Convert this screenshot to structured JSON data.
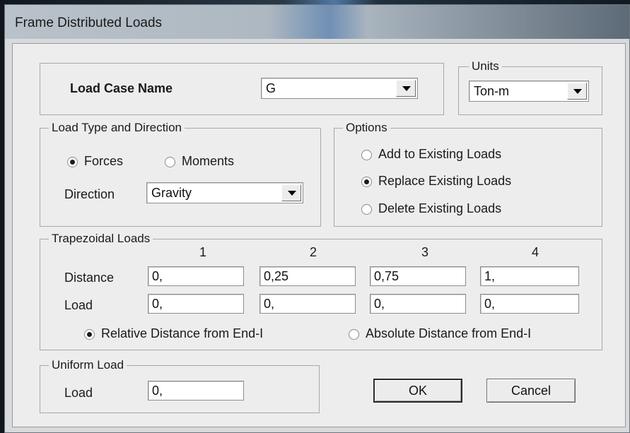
{
  "window": {
    "title": "Frame Distributed Loads"
  },
  "load_case": {
    "label": "Load Case Name",
    "value": "G"
  },
  "units": {
    "legend": "Units",
    "value": "Ton-m"
  },
  "load_type": {
    "legend": "Load Type and Direction",
    "forces_label": "Forces",
    "moments_label": "Moments",
    "selected": "Forces",
    "direction_label": "Direction",
    "direction_value": "Gravity"
  },
  "options": {
    "legend": "Options",
    "add_label": "Add to Existing Loads",
    "replace_label": "Replace Existing Loads",
    "delete_label": "Delete Existing Loads",
    "selected": "Replace Existing Loads"
  },
  "trapezoidal": {
    "legend": "Trapezoidal Loads",
    "columns": [
      "1",
      "2",
      "3",
      "4"
    ],
    "distance_label": "Distance",
    "load_label": "Load",
    "distances": [
      "0,",
      "0,25",
      "0,75",
      "1,"
    ],
    "loads": [
      "0,",
      "0,",
      "0,",
      "0,"
    ],
    "relative_label": "Relative Distance from End-I",
    "absolute_label": "Absolute Distance from End-I",
    "selected": "Relative Distance from End-I"
  },
  "uniform": {
    "legend": "Uniform Load",
    "load_label": "Load",
    "value": "0,"
  },
  "buttons": {
    "ok": "OK",
    "cancel": "Cancel"
  }
}
